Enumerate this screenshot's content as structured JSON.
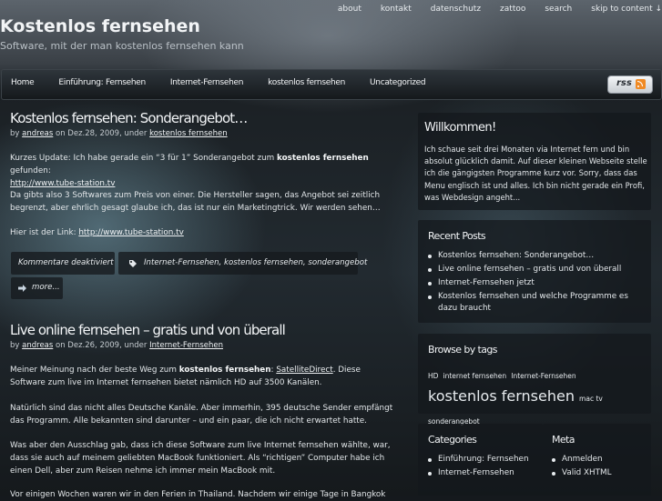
{
  "site": {
    "title": "Kostenlos fernsehen",
    "tagline": "Software, mit der man kostenlos fernsehen kann"
  },
  "topnav": [
    "about",
    "kontakt",
    "datenschutz",
    "zattoo",
    "search",
    "skip to content ↓"
  ],
  "mainnav": [
    "Home",
    "Einführung: Fernsehen",
    "Internet-Fernsehen",
    "kostenlos fernsehen",
    "Uncategorized"
  ],
  "rss": {
    "label": "rss"
  },
  "post1": {
    "title": "Kostenlos fernsehen: Sonderangebot…",
    "by": "by",
    "author": "andreas",
    "on_date": "on Dez.28, 2009, under",
    "category": "kostenlos fernsehen",
    "p1_a": "Kurzes Update: Ich habe gerade ein “3 für 1” Sonderangebot zum",
    "p1_b": "kostenlos fernsehen",
    "p1_c": "gefunden:",
    "p1_link": "http://www.tube-station.tv",
    "p2": "Da gibts also 3 Softwares zum Preis von einer. Die Hersteller sagen, das Angebot sei zeitlich begrenzt, aber ehrlich gesagt glaube ich, das ist nur ein Marketingtrick. Wir werden sehen…",
    "p3_a": "Hier ist der Link:",
    "p3_link": "http://www.tube-station.tv",
    "comments": "Kommentare deaktiviert",
    "tags": "Internet-Fernsehen, kostenlos fernsehen, sonderangebot",
    "more": "more..."
  },
  "post2": {
    "title": "Live online fernsehen – gratis und von überall",
    "by": "by",
    "author": "andreas",
    "on_date": "on Dez.26, 2009, under",
    "category": "Internet-Fernsehen",
    "p1_a": "Meiner Meinung nach der beste Weg zum",
    "p1_b": "kostenlos fernsehen",
    "p1_c": ":",
    "p1_link": "SatelliteDirect",
    "p1_d": ". Diese Software zum live im Internet fernsehen bietet nämlich HD auf 3500 Kanälen.",
    "p2": "Natürlich sind das nicht alles Deutsche Kanäle. Aber immerhin, 395 deutsche Sender empfängt das Programm. Alle bekannten sind darunter – und ein paar, die ich nicht erwartet hatte.",
    "p3": "Was aber den Ausschlag gab, dass ich diese Software zum live Internet fernsehen wählte, war, dass sie auch auf meinem geliebten MacBook funktioniert. Als “richtigen” Computer habe ich einen Dell, aber zum Reisen nehme ich immer mein MacBook mit.",
    "p4": "Vor einigen Wochen waren wir in den Ferien in Thailand. Nachdem wir einige Tage in Bangkok"
  },
  "sidebar": {
    "welcome_title": "Willkommen!",
    "welcome_text": "Ich schaue seit drei Monaten via Internet fern und bin absolut glücklich damit. Auf dieser kleinen Webseite stelle ich die gängigsten Programme kurz vor. Sorry, dass das Menu englisch ist und alles. Ich bin nicht gerade ein Profi, was Webdesign angeht...",
    "recent_title": "Recent Posts",
    "recent": [
      "Kostenlos fernsehen: Sonderangebot…",
      "Live online fernsehen – gratis und von überall",
      "Internet-Fernsehen jetzt",
      "Kostenlos fernsehen und welche Programme es dazu braucht"
    ],
    "tags_title": "Browse by tags",
    "tags": [
      "HD",
      "internet fernsehen",
      "Internet-Fernsehen",
      "kostenlos fernsehen",
      "mac tv",
      "sonderangebot"
    ],
    "categories_title": "Categories",
    "categories": [
      "Einführung: Fernsehen",
      "Internet-Fernsehen"
    ],
    "meta_title": "Meta",
    "meta": [
      "Anmelden",
      "Valid XHTML"
    ]
  }
}
